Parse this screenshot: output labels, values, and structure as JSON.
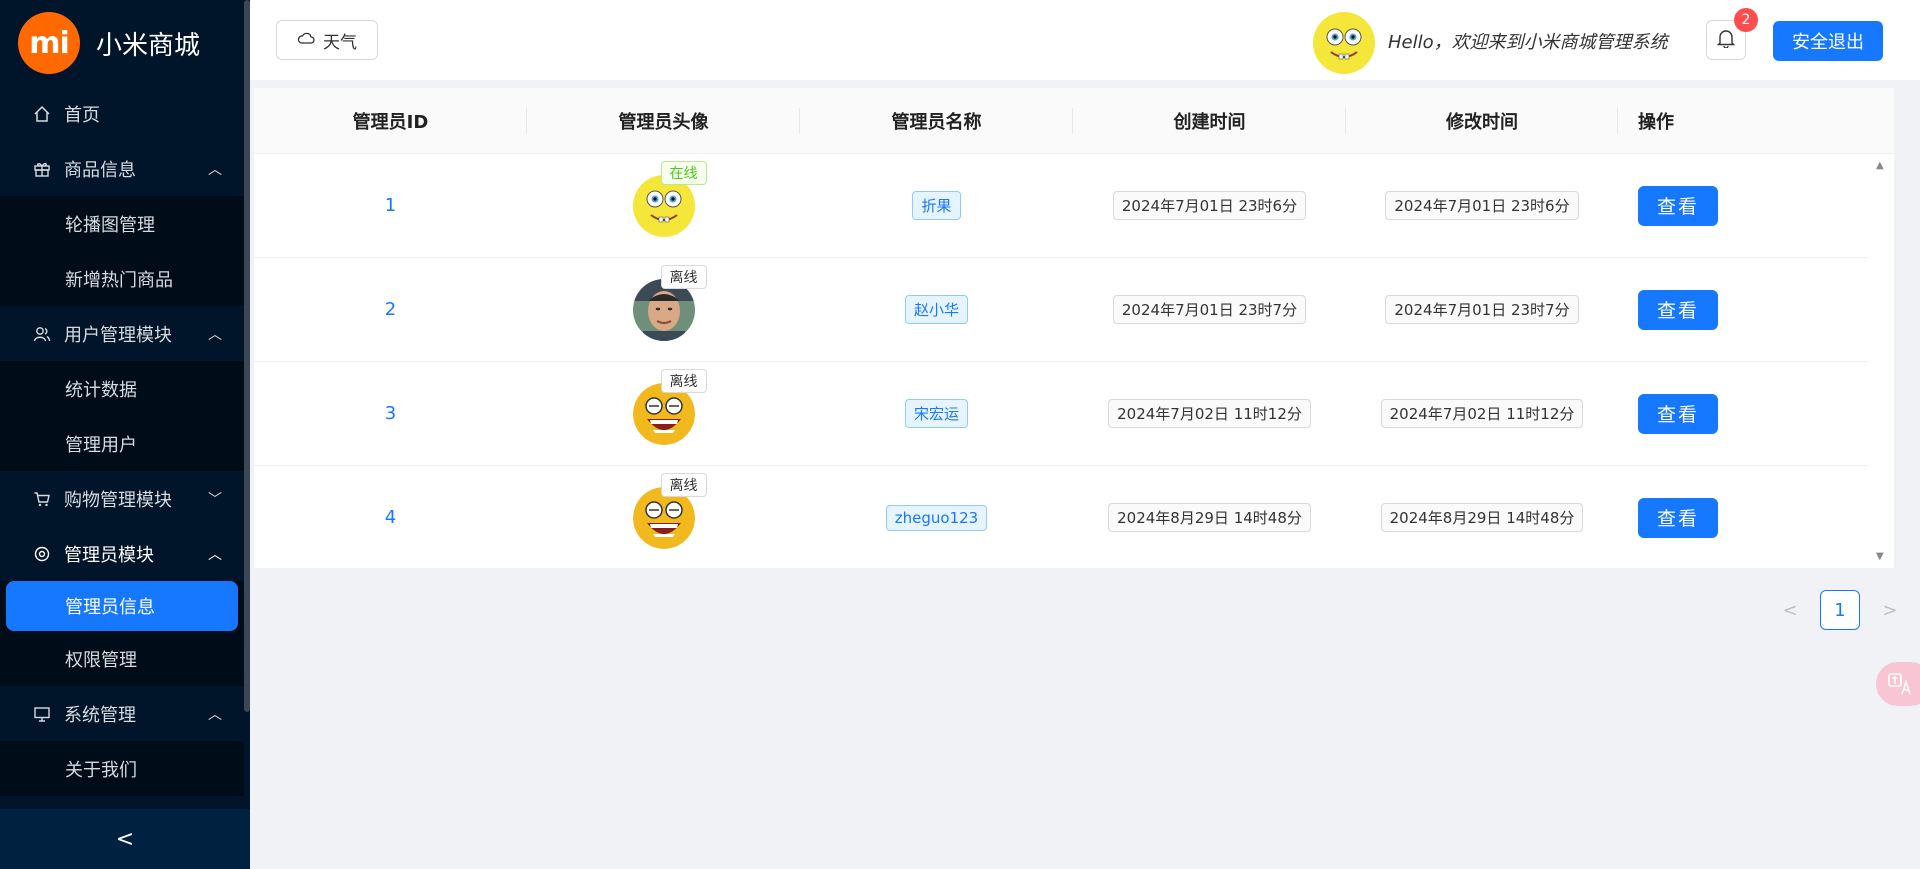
{
  "brand": {
    "logo_text": "mi",
    "name": "小米商城"
  },
  "sidebar": {
    "items": [
      {
        "label": "首页",
        "icon": "home-icon"
      },
      {
        "label": "商品信息",
        "icon": "gift-icon",
        "expanded": true,
        "children": [
          "轮播图管理",
          "新增热门商品"
        ]
      },
      {
        "label": "用户管理模块",
        "icon": "users-icon",
        "expanded": true,
        "children": [
          "统计数据",
          "管理用户"
        ]
      },
      {
        "label": "购物管理模块",
        "icon": "cart-icon",
        "expanded": false
      },
      {
        "label": "管理员模块",
        "icon": "admin-icon",
        "expanded": true,
        "children": [
          "管理员信息",
          "权限管理"
        ],
        "active_child": "管理员信息"
      },
      {
        "label": "系统管理",
        "icon": "monitor-icon",
        "expanded": true,
        "children": [
          "关于我们"
        ]
      }
    ],
    "collapse_glyph": "<"
  },
  "header": {
    "weather_label": "天气",
    "hello_text": "Hello，欢迎来到小米商城管理系统",
    "notification_count": "2",
    "logout_label": "安全退出"
  },
  "table": {
    "columns": [
      "管理员ID",
      "管理员头像",
      "管理员名称",
      "创建时间",
      "修改时间",
      "操作"
    ],
    "rows": [
      {
        "id": "1",
        "status": "在线",
        "name": "折果",
        "created": "2024年7月01日 23时6分",
        "updated": "2024年7月01日 23时6分",
        "action": "查看"
      },
      {
        "id": "2",
        "status": "离线",
        "name": "赵小华",
        "created": "2024年7月01日 23时7分",
        "updated": "2024年7月01日 23时7分",
        "action": "查看"
      },
      {
        "id": "3",
        "status": "离线",
        "name": "宋宏运",
        "created": "2024年7月02日 11时12分",
        "updated": "2024年7月02日 11时12分",
        "action": "查看"
      },
      {
        "id": "4",
        "status": "离线",
        "name": "zheguo123",
        "created": "2024年8月29日 14时48分",
        "updated": "2024年8月29日 14时48分",
        "action": "查看"
      }
    ]
  },
  "pagination": {
    "current": "1",
    "prev": "<",
    "next": ">"
  },
  "colors": {
    "primary": "#1677ff",
    "sidebar_bg": "#001529",
    "brand_orange": "#ff6900",
    "online": "#52c41a",
    "badge": "#ff4d4f"
  }
}
